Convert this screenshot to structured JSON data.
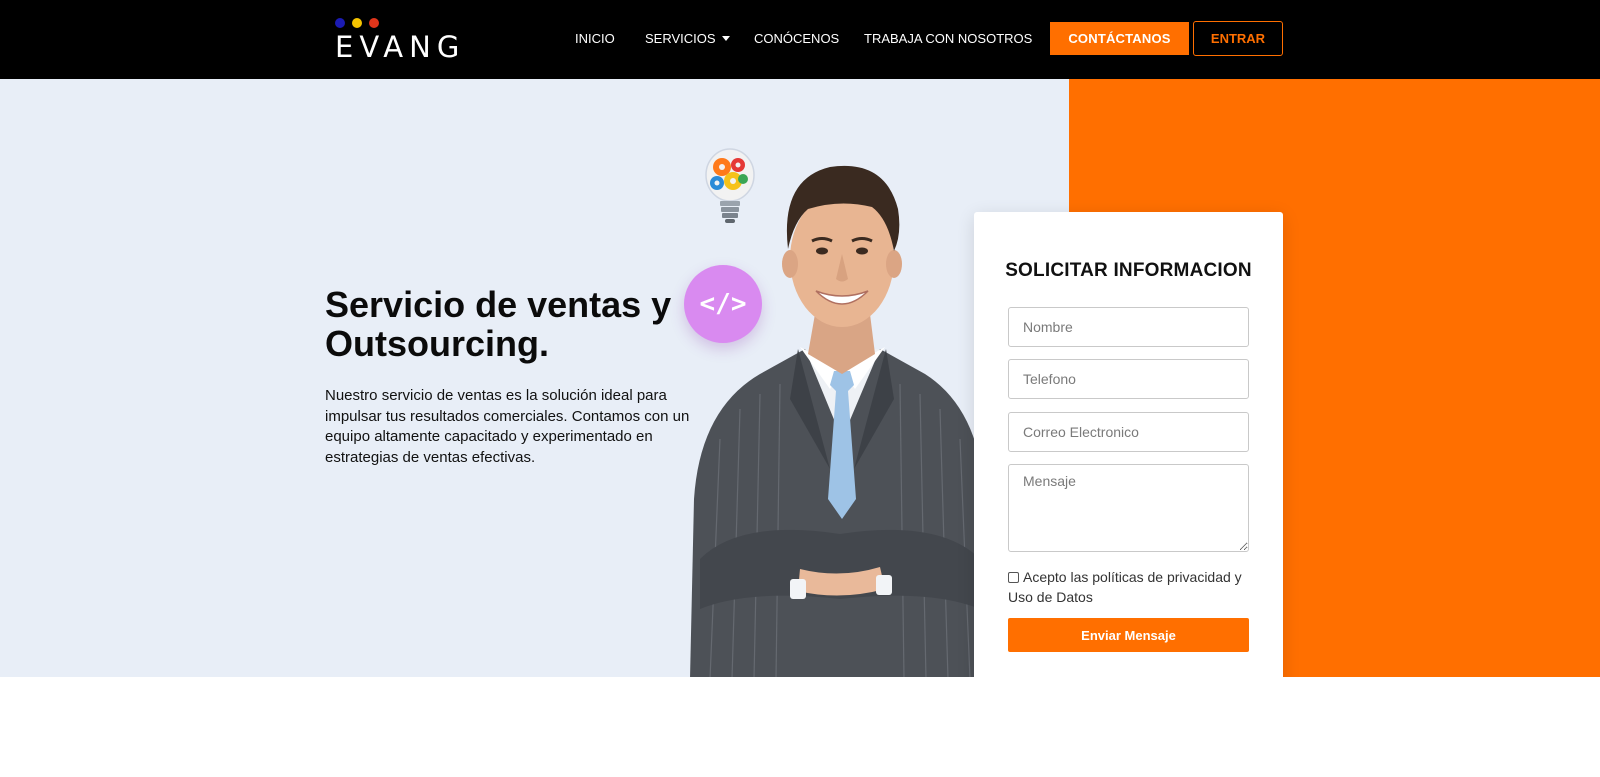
{
  "brand": {
    "logo_text": "EVANG",
    "dot_colors": [
      "#1b1bb3",
      "#f5c400",
      "#e0351b"
    ]
  },
  "nav": {
    "items": [
      {
        "label": "INICIO"
      },
      {
        "label": "SERVICIOS",
        "has_dropdown": true
      },
      {
        "label": "CONÓCENOS"
      },
      {
        "label": "TRABAJA CON NOSOTROS"
      }
    ],
    "contact_button": "CONTÁCTANOS",
    "login_button": "ENTRAR"
  },
  "hero": {
    "headline": "Servicio de ventas y Outsourcing.",
    "paragraph": "Nuestro servicio de ventas es la solución ideal para impulsar tus resultados comerciales. Contamos con un equipo altamente capacitado y experimentado en estrategias de ventas efectivas.",
    "code_symbol": "</>"
  },
  "form": {
    "title": "SOLICITAR INFORMACION",
    "name_placeholder": "Nombre",
    "phone_placeholder": "Telefono",
    "email_placeholder": "Correo Electronico",
    "message_placeholder": "Mensaje",
    "consent_label": "Acepto las políticas de privacidad y Uso de Datos",
    "submit_label": "Enviar Mensaje"
  },
  "colors": {
    "accent": "#ff6f00",
    "header_bg": "#000000",
    "hero_bg": "#e8eef7",
    "code_circle": "#d98af0"
  }
}
